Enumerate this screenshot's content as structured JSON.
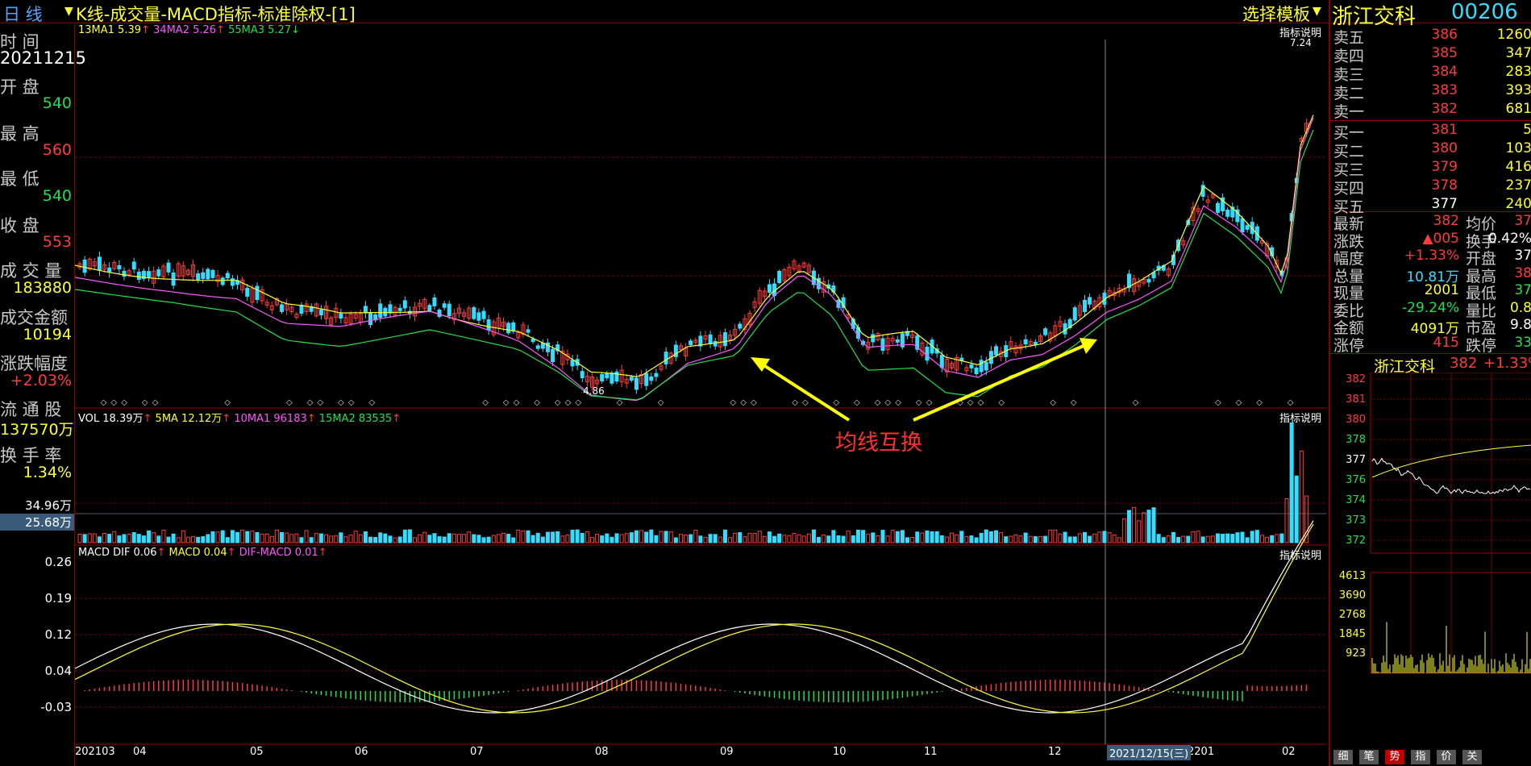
{
  "topbar": {
    "period": "日  线",
    "title": "K线-成交量-MACD指标-标准除权-[1]",
    "template": "选择模板",
    "stock_name": "浙江交科",
    "stock_code": "00206"
  },
  "left_panel": {
    "time_label": "时  间",
    "time_value": "20211215",
    "open_label": "开  盘",
    "open_value": "540",
    "high_label": "最  高",
    "high_value": "560",
    "low_label": "最  低",
    "low_value": "540",
    "close_label": "收  盘",
    "close_value": "553",
    "volume_label": "成 交 量",
    "volume_value": "183880",
    "amount_label": "成交金额",
    "amount_value": "10194",
    "change_label": "涨跌幅度",
    "change_value": "+2.03%",
    "float_label": "流 通 股",
    "float_value": "137570万",
    "turnover_label": "换 手 率",
    "turnover_value": "1.34%",
    "vol_axis_top": "34.96万",
    "vol_axis_cursor": "25.68万",
    "macd_axis": [
      "0.26",
      "0.19",
      "0.12",
      "0.04",
      "-0.03"
    ]
  },
  "kline": {
    "legend_ma1": "13MA1 5.39",
    "legend_ma2": "34MA2 5.26",
    "legend_ma3": "55MA3 5.27",
    "explain": "指标说明",
    "max_label": "7.24",
    "min_label": "4.86",
    "annotation": "均线互换"
  },
  "volume": {
    "legend_vol": "VOL 18.39万",
    "legend_ma5": "5MA 12.12万",
    "legend_ma10": "10MA1 96183",
    "legend_ma15": "15MA2 83535",
    "explain": "指标说明"
  },
  "macd": {
    "legend_dif": "MACD DIF 0.06",
    "legend_macd": "MACD 0.04",
    "legend_difmacd": "DIF-MACD 0.01",
    "explain": "指标说明"
  },
  "xaxis": {
    "labels": [
      "202103",
      "04",
      "05",
      "06",
      "07",
      "08",
      "09",
      "10",
      "11",
      "12",
      "2201",
      "02"
    ],
    "cursor_date": "2021/12/15(三)"
  },
  "orderbook": {
    "asks": [
      {
        "label": "卖五",
        "price": "386",
        "vol": "1260"
      },
      {
        "label": "卖四",
        "price": "385",
        "vol": "347"
      },
      {
        "label": "卖三",
        "price": "384",
        "vol": "283"
      },
      {
        "label": "卖二",
        "price": "383",
        "vol": "393"
      },
      {
        "label": "卖一",
        "price": "382",
        "vol": "681"
      }
    ],
    "bids": [
      {
        "label": "买一",
        "price": "381",
        "vol": "5"
      },
      {
        "label": "买二",
        "price": "380",
        "vol": "103"
      },
      {
        "label": "买三",
        "price": "379",
        "vol": "416"
      },
      {
        "label": "买四",
        "price": "378",
        "vol": "237"
      },
      {
        "label": "买五",
        "price": "377",
        "vol": "240"
      }
    ]
  },
  "stats": [
    {
      "l1": "最新",
      "v1": "382",
      "c1": "#ff3b3b",
      "l2": "均价",
      "v2": "37",
      "c2": "#ff3b3b"
    },
    {
      "l1": "涨跌",
      "v1": "▲005",
      "c1": "#ff3b3b",
      "l2": "换手",
      "v2": "0.42%",
      "c2": "#ffffff"
    },
    {
      "l1": "幅度",
      "v1": "+1.33%",
      "c1": "#ff3b3b",
      "l2": "开盘",
      "v2": "37",
      "c2": "#ffffff"
    },
    {
      "l1": "总量",
      "v1": "10.81万",
      "c1": "#33ddff",
      "l2": "最高",
      "v2": "38",
      "c2": "#ff3b3b"
    },
    {
      "l1": "现量",
      "v1": "2001",
      "c1": "#ffff33",
      "l2": "最低",
      "v2": "37",
      "c2": "#22e04a"
    },
    {
      "l1": "委比",
      "v1": "-29.24%",
      "c1": "#22e04a",
      "l2": "量比",
      "v2": "0.8",
      "c2": "#ffff33"
    },
    {
      "l1": "金额",
      "v1": "4091万",
      "c1": "#ffff33",
      "l2": "市盈",
      "v2": "9.8",
      "c2": "#ffffff"
    },
    {
      "l1": "涨停",
      "v1": "415",
      "c1": "#ff3b3b",
      "l2": "跌停",
      "v2": "33",
      "c2": "#22e04a"
    }
  ],
  "mini": {
    "name": "浙江交科",
    "price": "382",
    "change": "+1.33%",
    "price_axis": [
      "382",
      "381",
      "380",
      "378",
      "377",
      "376",
      "374",
      "373",
      "372"
    ],
    "vol_axis": [
      "4613",
      "3690",
      "2768",
      "1845",
      "923"
    ]
  },
  "tabs": [
    "细",
    "笔",
    "势",
    "指",
    "价",
    "关"
  ]
}
